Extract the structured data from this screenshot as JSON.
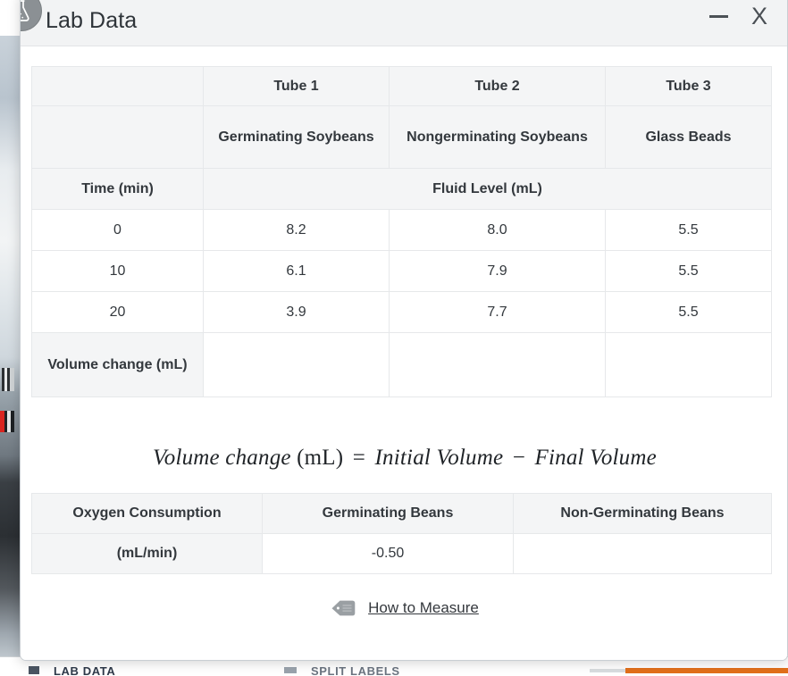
{
  "window": {
    "title": "Lab Data",
    "icon": "flask-icon",
    "minimize_label": "—",
    "close_label": "X"
  },
  "fluid_table": {
    "tube_headers": [
      "Tube 1",
      "Tube 2",
      "Tube 3"
    ],
    "sample_headers": [
      "Germinating Soybeans",
      "Nongerminating Soybeans",
      "Glass Beads"
    ],
    "time_header": "Time (min)",
    "measure_header": "Fluid Level (mL)",
    "rows": [
      {
        "time": "0",
        "tube1": "8.2",
        "tube2": "8.0",
        "tube3": "5.5"
      },
      {
        "time": "10",
        "tube1": "6.1",
        "tube2": "7.9",
        "tube3": "5.5"
      },
      {
        "time": "20",
        "tube1": "3.9",
        "tube2": "7.7",
        "tube3": "5.5"
      }
    ],
    "volume_change_label": "Volume change (mL)",
    "volume_change_values": [
      "",
      "",
      ""
    ]
  },
  "equation": {
    "lhs": "Volume change",
    "lhs_unit": "(mL)",
    "equals": "=",
    "rhs_first": "Initial Volume",
    "minus": "−",
    "rhs_second": "Final Volume"
  },
  "oxygen_table": {
    "headers": [
      "Oxygen Consumption",
      "Germinating Beans",
      "Non-Germinating Beans"
    ],
    "unit_label": "(mL/min)",
    "values": [
      "-0.50",
      ""
    ]
  },
  "how_to_measure": {
    "icon": "tag-icon",
    "label": "How to Measure"
  },
  "background_toolbar": {
    "label_left": "LAB DATA",
    "label_right": "SPLIT LABELS"
  },
  "colors": {
    "titlebar_bg": "#f2f3f4",
    "table_header_bg": "#f4f5f6",
    "border": "#e6e8ea",
    "text": "#33383d",
    "accent_orange": "#e2701b",
    "badge_gray": "#8b9094"
  }
}
